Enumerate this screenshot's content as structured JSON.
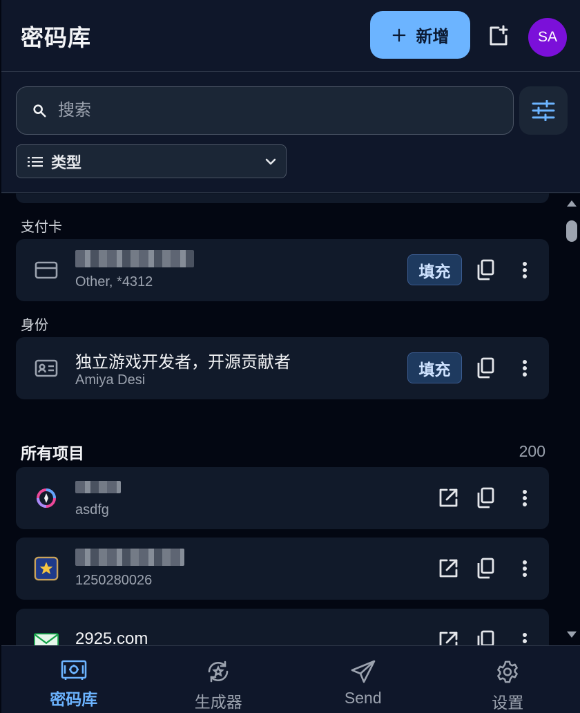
{
  "header": {
    "title": "密码库",
    "new_label": "新增",
    "avatar_initials": "SA"
  },
  "search": {
    "placeholder": "搜索",
    "type_filter_label": "类型"
  },
  "sections": {
    "cards_label": "支付卡",
    "identities_label": "身份",
    "all_items_label": "所有项目",
    "all_items_count": "200"
  },
  "card_items": [
    {
      "name": "",
      "subtitle": "Other, *4312",
      "fill_label": "填充",
      "icon": "credit-card-icon"
    }
  ],
  "identity_items": [
    {
      "name": "独立游戏开发者，开源贡献者",
      "subtitle": "Amiya Desi",
      "fill_label": "填充",
      "icon": "id-card-icon"
    }
  ],
  "all_items": [
    {
      "name": "",
      "subtitle": "asdfg",
      "icon": "colorful-swirl-logo-icon"
    },
    {
      "name": "",
      "subtitle": "1250280026",
      "icon": "star-badge-logo-icon"
    },
    {
      "name": "2925.com",
      "subtitle": "",
      "icon": "mail-logo-icon"
    }
  ],
  "bottom_nav": [
    {
      "label": "密码库",
      "icon": "vault-icon",
      "active": true
    },
    {
      "label": "生成器",
      "icon": "generator-icon",
      "active": false
    },
    {
      "label": "Send",
      "icon": "send-icon",
      "active": false
    },
    {
      "label": "设置",
      "icon": "settings-gear-icon",
      "active": false
    }
  ],
  "colors": {
    "accent": "#6cb4ff",
    "avatar": "#7b10d9",
    "background": "#030712",
    "card": "#111a2a"
  }
}
